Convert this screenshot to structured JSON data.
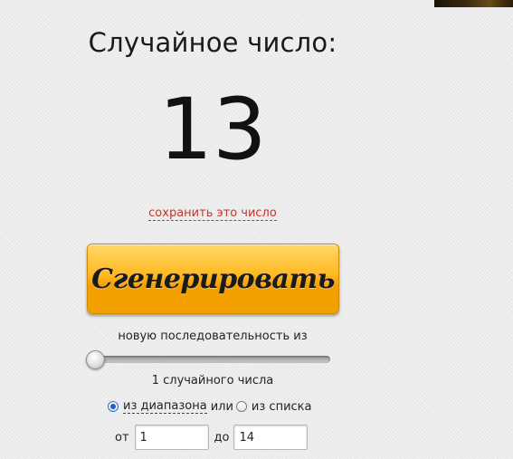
{
  "title": "Случайное число:",
  "result": "13",
  "save_link": "сохранить это число",
  "generate_button": "Сгенерировать",
  "sequence_label": "новую последовательность из",
  "count": {
    "value": 1,
    "label": "1 случайного числа"
  },
  "mode": {
    "range_label": "из диапазона",
    "or_label": "или",
    "list_label": "из списка",
    "selected": "range"
  },
  "range": {
    "from_label": "от",
    "from_value": "1",
    "to_label": "до",
    "to_value": "14"
  },
  "colors": {
    "button_accent": "#ffb820",
    "link": "#c0392b",
    "radio_selected": "#1f5fc0"
  }
}
